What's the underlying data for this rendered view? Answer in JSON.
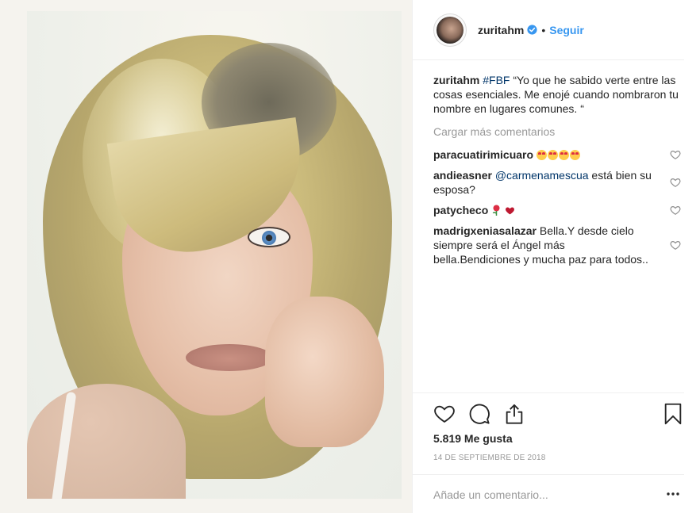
{
  "header": {
    "username": "zuritahm",
    "separator": "•",
    "follow_label": "Seguir",
    "avatar_icon": "profile-avatar",
    "verified_icon": "verified-badge-icon"
  },
  "caption": {
    "username": "zuritahm",
    "hashtag": "#FBF",
    "text": " “Yo que he sabido verte entre las cosas esenciales. Me enojé cuando nombraron tu nombre en lugares comunes. “"
  },
  "load_more_label": "Cargar más comentarios",
  "comments": [
    {
      "username": "paracuatirimicuaro",
      "mention": "",
      "text": "",
      "emoji": "heart-eyes x4"
    },
    {
      "username": "andieasner",
      "mention": "@carmenamescua",
      "text": " está bien su esposa?",
      "emoji": ""
    },
    {
      "username": "patycheco",
      "mention": "",
      "text": "",
      "emoji": "rose, red-heart"
    },
    {
      "username": "madrigxeniasalazar",
      "mention": "",
      "text": "Bella.Y desde cielo siempre será el Ángel más bella.Bendiciones y mucha paz para todos..",
      "emoji": ""
    }
  ],
  "actions": {
    "like_icon": "heart-outline-icon",
    "comment_icon": "comment-bubble-icon",
    "share_icon": "share-upload-icon",
    "save_icon": "bookmark-icon"
  },
  "likes_label": "5.819 Me gusta",
  "date_label": "14 DE SEPTIEMBRE DE 2018",
  "add_comment": {
    "placeholder": "Añade un comentario...",
    "more_icon": "more-options-icon"
  },
  "colors": {
    "link_blue": "#3897f0",
    "hashtag_navy": "#003569",
    "muted_gray": "#999999",
    "text": "#262626",
    "border": "#efefef"
  }
}
